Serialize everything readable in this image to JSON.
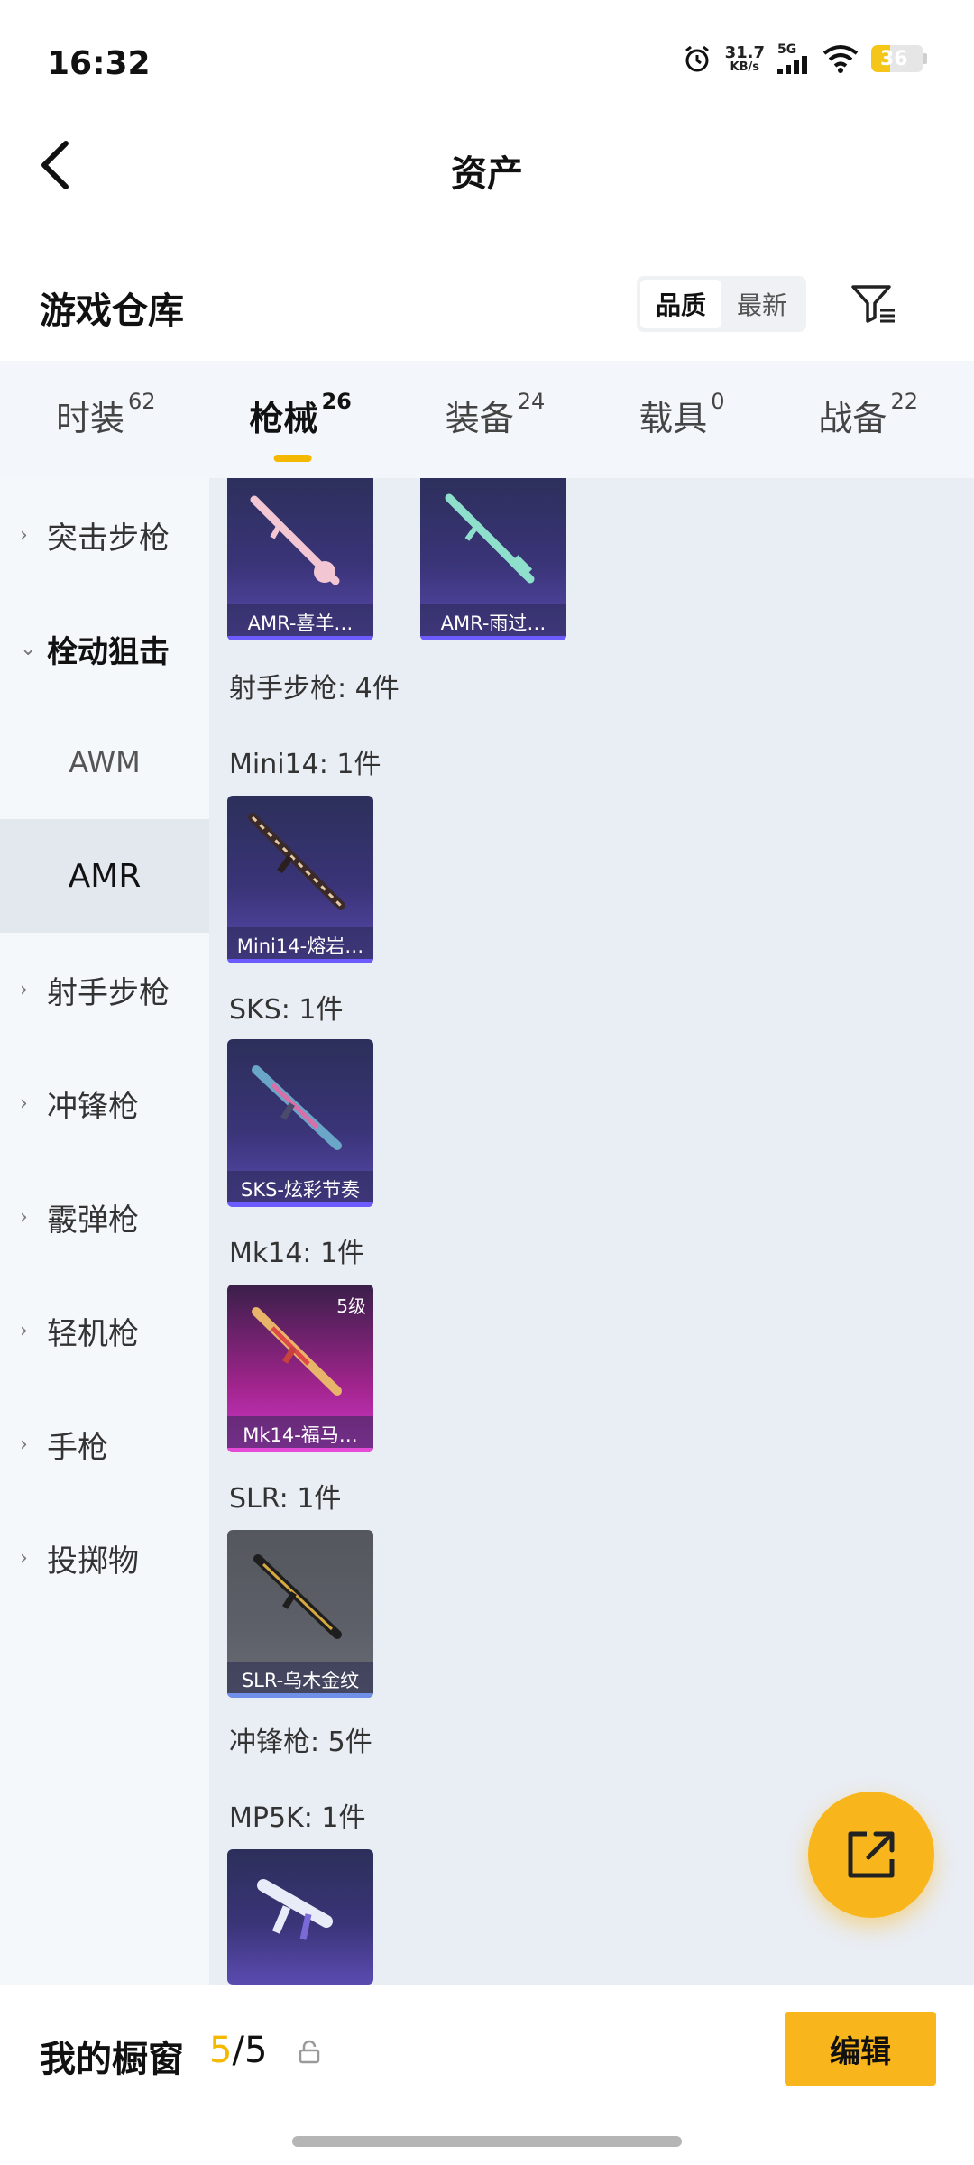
{
  "status_bar": {
    "time": "16:32",
    "net_speed": "31.7",
    "net_unit": "KB/s",
    "network": "5G",
    "battery": "36"
  },
  "header": {
    "title": "资产",
    "back_icon": "chevron-left-icon"
  },
  "warehouse": {
    "title": "游戏仓库",
    "sort_options": [
      "品质",
      "最新"
    ],
    "active_sort": "品质",
    "filter_icon": "filter-icon"
  },
  "tabs": [
    {
      "label": "时装",
      "count": "62"
    },
    {
      "label": "枪械",
      "count": "26"
    },
    {
      "label": "装备",
      "count": "24"
    },
    {
      "label": "载具",
      "count": "0"
    },
    {
      "label": "战备",
      "count": "22"
    }
  ],
  "active_tab": "枪械",
  "sidebar": {
    "categories": [
      {
        "label": "突击步枪"
      },
      {
        "label": "栓动狙击",
        "subitems": [
          "AWM",
          "AMR"
        ]
      },
      {
        "label": "射手步枪"
      },
      {
        "label": "冲锋枪"
      },
      {
        "label": "霰弹枪"
      },
      {
        "label": "轻机枪"
      },
      {
        "label": "手枪"
      },
      {
        "label": "投掷物"
      }
    ],
    "active_subitem": "AMR"
  },
  "content": {
    "amr_items": [
      {
        "name": "AMR-喜羊…",
        "rarity": "purple"
      },
      {
        "name": "AMR-雨过…",
        "rarity": "purple"
      }
    ],
    "marksman_summary": "射手步枪: 4件",
    "groups": [
      {
        "label": "Mini14: 1件",
        "items": [
          {
            "name": "Mini14-熔岩…",
            "rarity": "purple"
          }
        ]
      },
      {
        "label": "SKS: 1件",
        "items": [
          {
            "name": "SKS-炫彩节奏",
            "rarity": "purple"
          }
        ]
      },
      {
        "label": "Mk14: 1件",
        "items": [
          {
            "name": "Mk14-福马…",
            "rarity": "pink",
            "level": "5级"
          }
        ]
      },
      {
        "label": "SLR: 1件",
        "items": [
          {
            "name": "SLR-乌木金纹",
            "rarity": "gray"
          }
        ]
      }
    ],
    "smg_summary": "冲锋枪: 5件",
    "mp5k_label": "MP5K: 1件",
    "mp5k_items": [
      {
        "name": "",
        "rarity": "purple"
      }
    ]
  },
  "fab": {
    "icon": "share-external-icon"
  },
  "bottom": {
    "showcase_label": "我的橱窗",
    "showcase_current": "5",
    "showcase_separator": "/",
    "showcase_total": "5",
    "lock_icon": "lock-icon",
    "edit_label": "编辑"
  },
  "colors": {
    "accent": "#f8b51c",
    "purple_rarity": "#6c5cff",
    "pink_rarity": "#e64bd8"
  }
}
